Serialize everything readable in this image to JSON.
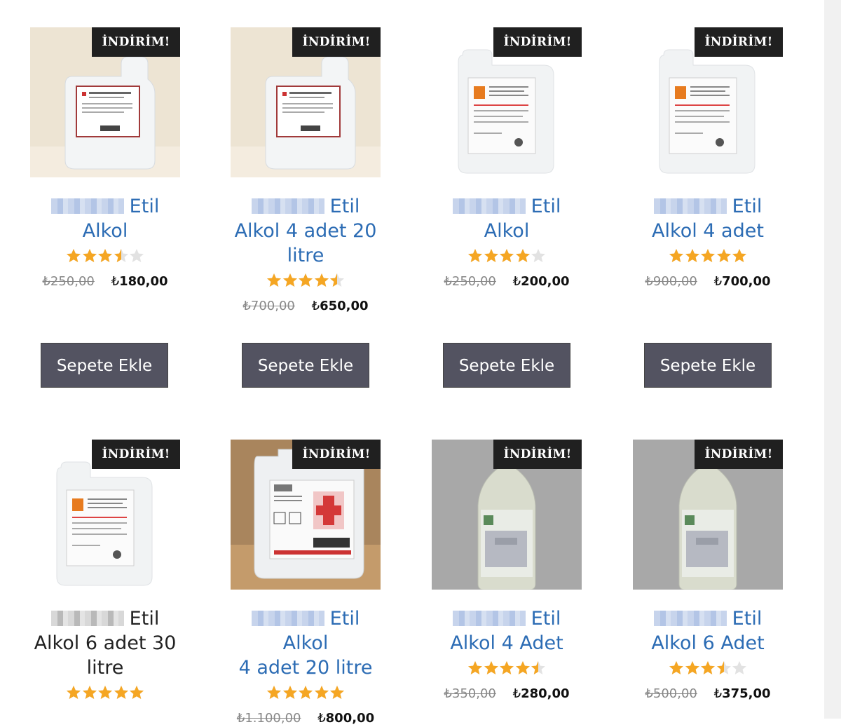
{
  "sale_badge": "İNDİRİM!",
  "currency_glyph": "₺",
  "colors": {
    "link": "#2c6cb4",
    "star": "#f5a623",
    "button": "#535361",
    "badge": "#202020"
  },
  "products": [
    {
      "title_rest": "Etil",
      "title_line2": "Alkol",
      "rating": 3.5,
      "old_price": "250,00",
      "price": "180,00",
      "button": "Sepete Ekle",
      "image": "jug-red-label-beige"
    },
    {
      "title_rest": "Etil",
      "title_line2": "Alkol 4 adet 20",
      "title_line3": "litre",
      "rating": 4.5,
      "old_price": "700,00",
      "price": "650,00",
      "button": "Sepete Ekle",
      "image": "jug-red-label-beige"
    },
    {
      "title_rest": "Etil",
      "title_line2": "Alkol",
      "rating": 4.0,
      "old_price": "250,00",
      "price": "200,00",
      "button": "Sepete Ekle",
      "image": "jug-white-label"
    },
    {
      "title_rest": "Etil",
      "title_line2": "Alkol 4 adet",
      "rating": 5.0,
      "old_price": "900,00",
      "price": "700,00",
      "button": "Sepete Ekle",
      "image": "jug-white-label"
    },
    {
      "title_rest": "Etil",
      "title_line2": "Alkol 6 adet 30",
      "title_line3": "litre",
      "rating": 5.0,
      "image": "jug-white-label"
    },
    {
      "title_rest": "Etil Alkol",
      "title_line2": "4 adet 20 litre",
      "rating": 5.0,
      "old_price": "1.100,00",
      "price": "800,00",
      "image": "canister-red-cross"
    },
    {
      "title_rest": "Etil",
      "title_line2": "Alkol 4 Adet",
      "rating": 4.5,
      "old_price": "350,00",
      "price": "280,00",
      "image": "bottle-gray"
    },
    {
      "title_rest": "Etil",
      "title_line2": "Alkol 6 Adet",
      "rating": 3.5,
      "old_price": "500,00",
      "price": "375,00",
      "image": "bottle-gray"
    }
  ]
}
